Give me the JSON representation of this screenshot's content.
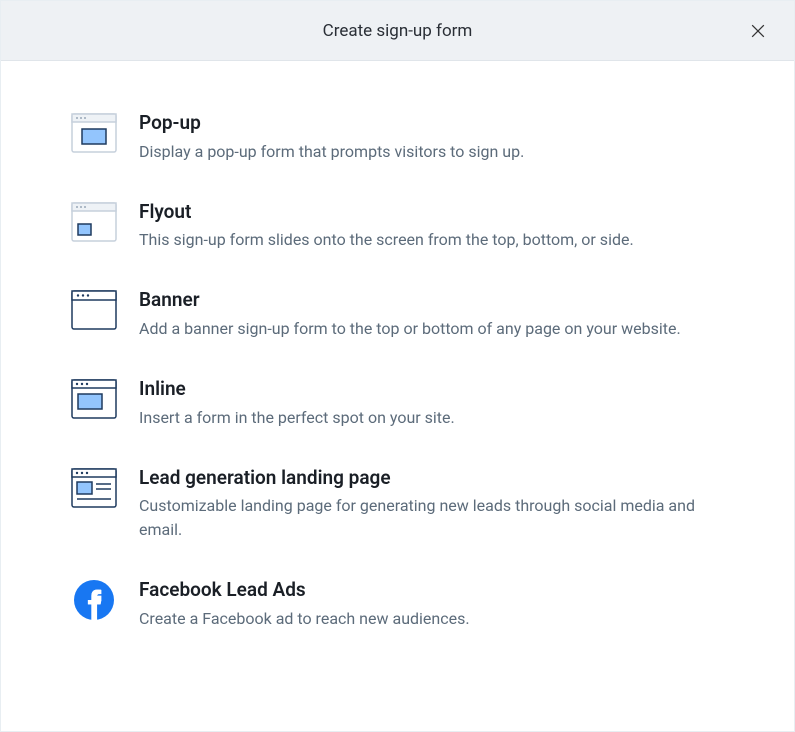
{
  "modal": {
    "title": "Create sign-up form"
  },
  "options": [
    {
      "title": "Pop-up",
      "description": "Display a pop-up form that prompts visitors to sign up."
    },
    {
      "title": "Flyout",
      "description": "This sign-up form slides onto the screen from the top, bottom, or side."
    },
    {
      "title": "Banner",
      "description": "Add a banner sign-up form to the top or bottom of any page on your website."
    },
    {
      "title": "Inline",
      "description": "Insert a form in the perfect spot on your site."
    },
    {
      "title": "Lead generation landing page",
      "description": "Customizable landing page for generating new leads through social media and email."
    },
    {
      "title": "Facebook Lead Ads",
      "description": "Create a Facebook ad to reach new audiences."
    }
  ]
}
